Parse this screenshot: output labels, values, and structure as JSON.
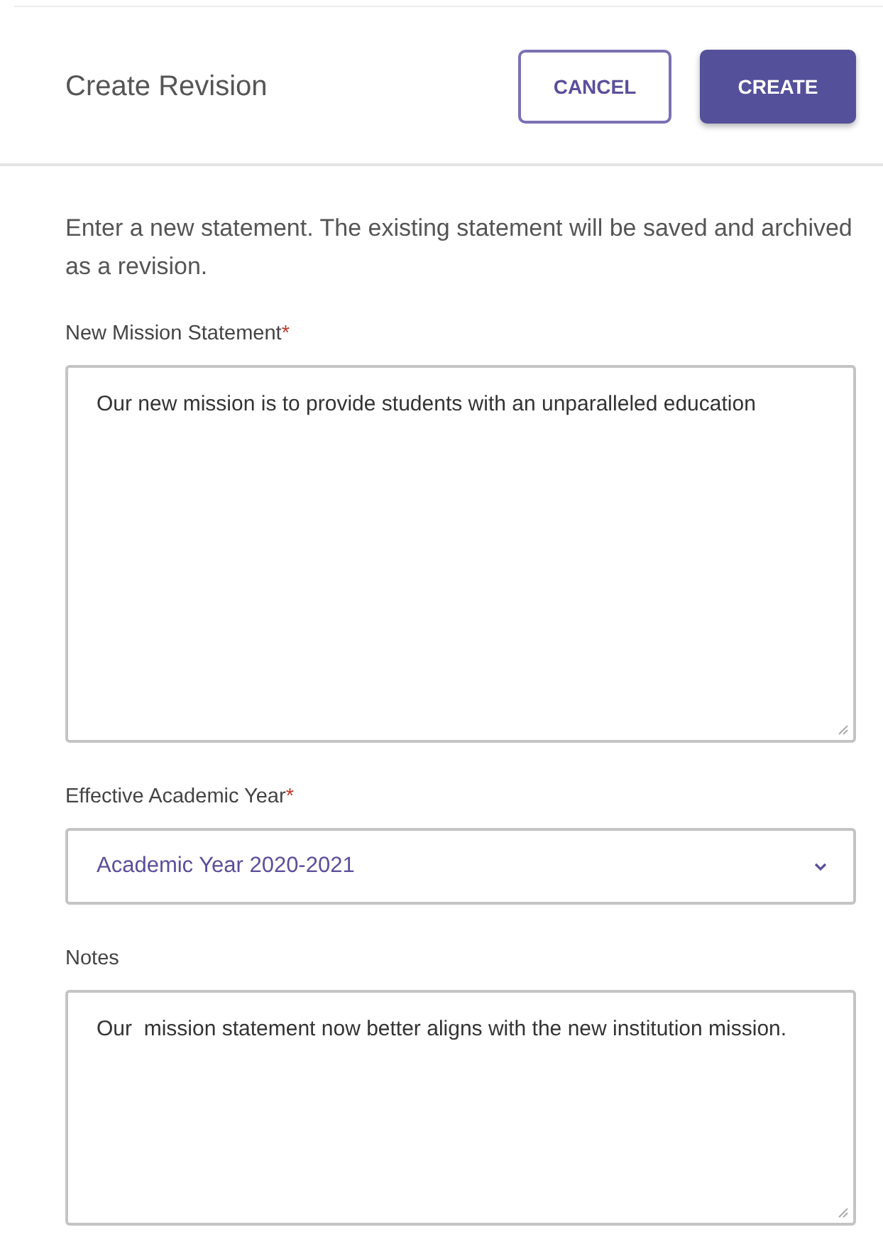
{
  "header": {
    "title": "Create Revision",
    "buttons": [
      {
        "label": "CANCEL",
        "kind": "outline"
      },
      {
        "label": "CREATE",
        "kind": "primary"
      }
    ]
  },
  "intro": "Enter a new statement. The existing statement will be saved and archived as a revision.",
  "fields": [
    {
      "kind": "textarea",
      "label": "New Mission Statement",
      "required_mark": "*",
      "value": "Our new mission is to provide students with an unparalleled education"
    },
    {
      "kind": "select",
      "label": "Effective Academic Year",
      "required_mark": "*",
      "value": "Academic Year 2020-2021"
    },
    {
      "kind": "textarea",
      "label": "Notes",
      "value": "Our  mission statement now better aligns with the new institution mission."
    }
  ]
}
